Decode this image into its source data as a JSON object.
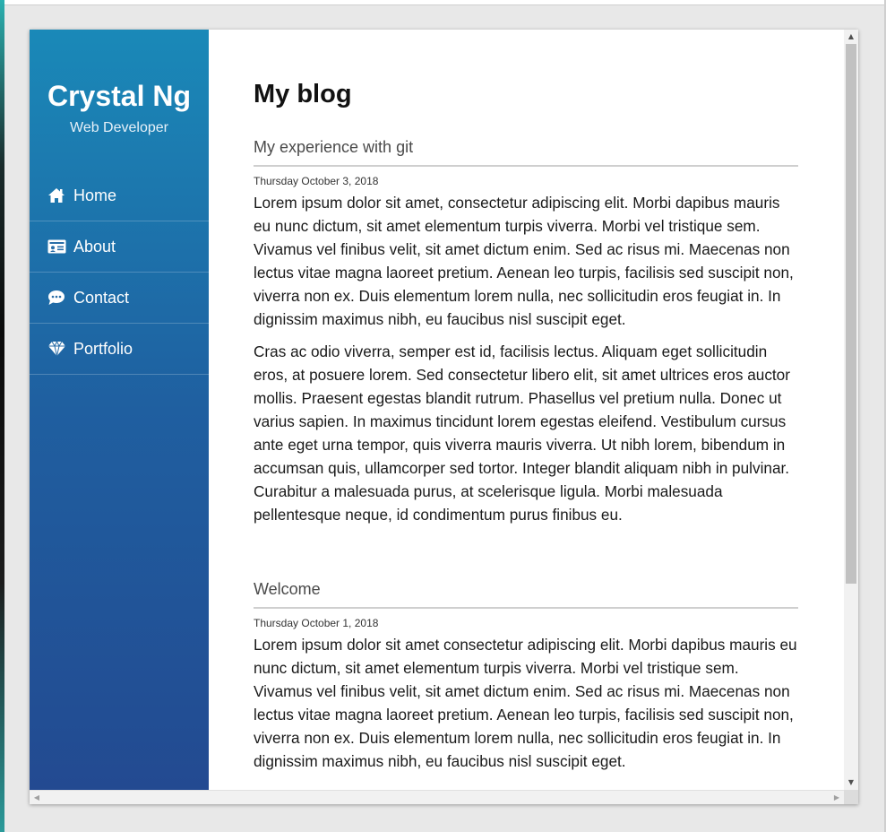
{
  "profile": {
    "name": "Crystal Ng",
    "role": "Web Developer"
  },
  "nav": {
    "items": [
      {
        "label": "Home",
        "icon": "home-icon"
      },
      {
        "label": "About",
        "icon": "id-card-icon"
      },
      {
        "label": "Contact",
        "icon": "chat-bubble-icon"
      },
      {
        "label": "Portfolio",
        "icon": "diamond-icon"
      }
    ]
  },
  "main": {
    "title": "My blog",
    "posts": [
      {
        "title": "My experience with git",
        "date": "Thursday October 3, 2018",
        "paragraphs": [
          "Lorem ipsum dolor sit amet, consectetur adipiscing elit. Morbi dapibus mauris eu nunc dictum, sit amet elementum turpis viverra. Morbi vel tristique sem. Vivamus vel finibus velit, sit amet dictum enim. Sed ac risus mi. Maecenas non lectus vitae magna laoreet pretium. Aenean leo turpis, facilisis sed suscipit non, viverra non ex. Duis elementum lorem nulla, nec sollicitudin eros feugiat in. In dignissim maximus nibh, eu faucibus nisl suscipit eget.",
          "Cras ac odio viverra, semper est id, facilisis lectus. Aliquam eget sollicitudin eros, at posuere lorem. Sed consectetur libero elit, sit amet ultrices eros auctor mollis. Praesent egestas blandit rutrum. Phasellus vel pretium nulla. Donec ut varius sapien. In maximus tincidunt lorem egestas eleifend. Vestibulum cursus ante eget urna tempor, quis viverra mauris viverra. Ut nibh lorem, bibendum in accumsan quis, ullamcorper sed tortor. Integer blandit aliquam nibh in pulvinar. Curabitur a malesuada purus, at scelerisque ligula. Morbi malesuada pellentesque neque, id condimentum purus finibus eu."
        ]
      },
      {
        "title": "Welcome",
        "date": "Thursday October 1, 2018",
        "paragraphs": [
          "Lorem ipsum dolor sit amet consectetur adipiscing elit. Morbi dapibus mauris eu nunc dictum, sit amet elementum turpis viverra. Morbi vel tristique sem. Vivamus vel finibus velit, sit amet dictum enim. Sed ac risus mi. Maecenas non lectus vitae magna laoreet pretium. Aenean leo turpis, facilisis sed suscipit non, viverra non ex. Duis elementum lorem nulla, nec sollicitudin eros feugiat in. In dignissim maximus nibh, eu faucibus nisl suscipit eget."
        ]
      }
    ]
  },
  "scrollbars": {
    "vertical_position": 0,
    "arrow_up": "▲",
    "arrow_down": "▼",
    "arrow_left": "◀",
    "arrow_right": "▶"
  },
  "colors": {
    "sidebar_top": "#1a89b8",
    "sidebar_bottom": "#234a91",
    "accent_text": "#ffffff"
  }
}
